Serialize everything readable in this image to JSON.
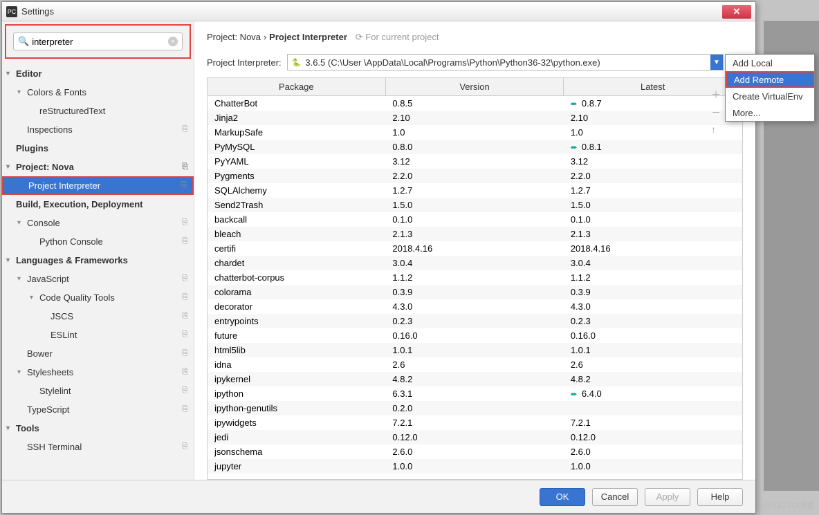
{
  "window": {
    "title": "Settings",
    "app_icon": "PC"
  },
  "search": {
    "placeholder": "",
    "value": "interpreter"
  },
  "tree": [
    {
      "label": "Editor",
      "bold": true,
      "indent": 0,
      "arrow": "▾",
      "copy": false
    },
    {
      "label": "Colors & Fonts",
      "bold": false,
      "indent": 1,
      "arrow": "▾",
      "copy": false
    },
    {
      "label": "reStructuredText",
      "bold": false,
      "indent": 2,
      "arrow": "",
      "copy": false
    },
    {
      "label": "Inspections",
      "bold": false,
      "indent": 1,
      "arrow": "",
      "copy": true
    },
    {
      "label": "Plugins",
      "bold": true,
      "indent": 0,
      "arrow": "",
      "copy": false
    },
    {
      "label": "Project: Nova",
      "bold": true,
      "indent": 0,
      "arrow": "▾",
      "copy": true
    },
    {
      "label": "Project Interpreter",
      "bold": false,
      "indent": 1,
      "arrow": "",
      "copy": true,
      "selected": true
    },
    {
      "label": "Build, Execution, Deployment",
      "bold": true,
      "indent": 0,
      "arrow": "",
      "copy": false
    },
    {
      "label": "Console",
      "bold": false,
      "indent": 1,
      "arrow": "▾",
      "copy": true
    },
    {
      "label": "Python Console",
      "bold": false,
      "indent": 2,
      "arrow": "",
      "copy": true
    },
    {
      "label": "Languages & Frameworks",
      "bold": true,
      "indent": 0,
      "arrow": "▾",
      "copy": false
    },
    {
      "label": "JavaScript",
      "bold": false,
      "indent": 1,
      "arrow": "▾",
      "copy": true
    },
    {
      "label": "Code Quality Tools",
      "bold": false,
      "indent": 2,
      "arrow": "▾",
      "copy": true
    },
    {
      "label": "JSCS",
      "bold": false,
      "indent": 3,
      "arrow": "",
      "copy": true
    },
    {
      "label": "ESLint",
      "bold": false,
      "indent": 3,
      "arrow": "",
      "copy": true
    },
    {
      "label": "Bower",
      "bold": false,
      "indent": 1,
      "arrow": "",
      "copy": true
    },
    {
      "label": "Stylesheets",
      "bold": false,
      "indent": 1,
      "arrow": "▾",
      "copy": true
    },
    {
      "label": "Stylelint",
      "bold": false,
      "indent": 2,
      "arrow": "",
      "copy": true
    },
    {
      "label": "TypeScript",
      "bold": false,
      "indent": 1,
      "arrow": "",
      "copy": true
    },
    {
      "label": "Tools",
      "bold": true,
      "indent": 0,
      "arrow": "▾",
      "copy": false
    },
    {
      "label": "SSH Terminal",
      "bold": false,
      "indent": 1,
      "arrow": "",
      "copy": true
    }
  ],
  "breadcrumb": {
    "part1": "Project: Nova",
    "sep": "›",
    "part2": "Project Interpreter",
    "scope_icon": "⟳",
    "scope": "For current project"
  },
  "interpreter": {
    "label": "Project Interpreter:",
    "path": "3.6.5 (C:\\User           \\AppData\\Local\\Programs\\Python\\Python36-32\\python.exe)"
  },
  "columns": [
    "Package",
    "Version",
    "Latest"
  ],
  "packages": [
    {
      "name": "ChatterBot",
      "ver": "0.8.5",
      "latest": "0.8.7",
      "up": true
    },
    {
      "name": "Jinja2",
      "ver": "2.10",
      "latest": "2.10",
      "up": false
    },
    {
      "name": "MarkupSafe",
      "ver": "1.0",
      "latest": "1.0",
      "up": false
    },
    {
      "name": "PyMySQL",
      "ver": "0.8.0",
      "latest": "0.8.1",
      "up": true
    },
    {
      "name": "PyYAML",
      "ver": "3.12",
      "latest": "3.12",
      "up": false
    },
    {
      "name": "Pygments",
      "ver": "2.2.0",
      "latest": "2.2.0",
      "up": false
    },
    {
      "name": "SQLAlchemy",
      "ver": "1.2.7",
      "latest": "1.2.7",
      "up": false
    },
    {
      "name": "Send2Trash",
      "ver": "1.5.0",
      "latest": "1.5.0",
      "up": false
    },
    {
      "name": "backcall",
      "ver": "0.1.0",
      "latest": "0.1.0",
      "up": false
    },
    {
      "name": "bleach",
      "ver": "2.1.3",
      "latest": "2.1.3",
      "up": false
    },
    {
      "name": "certifi",
      "ver": "2018.4.16",
      "latest": "2018.4.16",
      "up": false
    },
    {
      "name": "chardet",
      "ver": "3.0.4",
      "latest": "3.0.4",
      "up": false
    },
    {
      "name": "chatterbot-corpus",
      "ver": "1.1.2",
      "latest": "1.1.2",
      "up": false
    },
    {
      "name": "colorama",
      "ver": "0.3.9",
      "latest": "0.3.9",
      "up": false
    },
    {
      "name": "decorator",
      "ver": "4.3.0",
      "latest": "4.3.0",
      "up": false
    },
    {
      "name": "entrypoints",
      "ver": "0.2.3",
      "latest": "0.2.3",
      "up": false
    },
    {
      "name": "future",
      "ver": "0.16.0",
      "latest": "0.16.0",
      "up": false
    },
    {
      "name": "html5lib",
      "ver": "1.0.1",
      "latest": "1.0.1",
      "up": false
    },
    {
      "name": "idna",
      "ver": "2.6",
      "latest": "2.6",
      "up": false
    },
    {
      "name": "ipykernel",
      "ver": "4.8.2",
      "latest": "4.8.2",
      "up": false
    },
    {
      "name": "ipython",
      "ver": "6.3.1",
      "latest": "6.4.0",
      "up": true
    },
    {
      "name": "ipython-genutils",
      "ver": "0.2.0",
      "latest": "",
      "up": false
    },
    {
      "name": "ipywidgets",
      "ver": "7.2.1",
      "latest": "7.2.1",
      "up": false
    },
    {
      "name": "jedi",
      "ver": "0.12.0",
      "latest": "0.12.0",
      "up": false
    },
    {
      "name": "jsonschema",
      "ver": "2.6.0",
      "latest": "2.6.0",
      "up": false
    },
    {
      "name": "jupyter",
      "ver": "1.0.0",
      "latest": "1.0.0",
      "up": false
    }
  ],
  "dropdown": [
    {
      "label": "Add Local",
      "sel": false
    },
    {
      "label": "Add Remote",
      "sel": true
    },
    {
      "label": "Create VirtualEnv",
      "sel": false
    },
    {
      "label": "More...",
      "sel": false
    }
  ],
  "buttons": {
    "ok": "OK",
    "cancel": "Cancel",
    "apply": "Apply",
    "help": "Help"
  },
  "watermark": "@51CTO博客"
}
